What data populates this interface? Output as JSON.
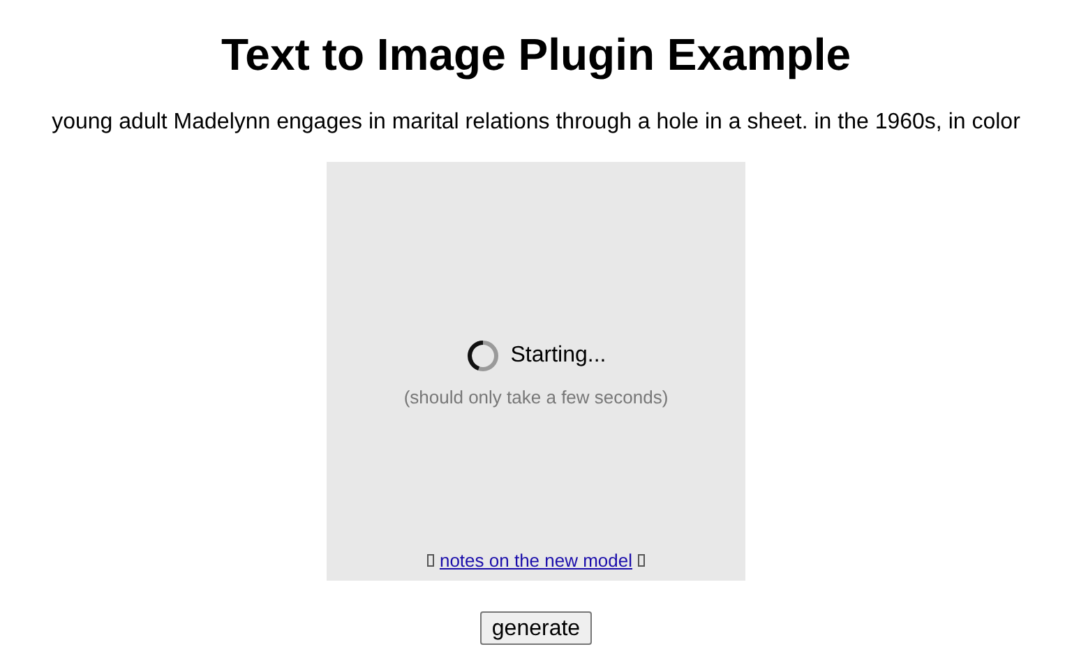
{
  "title": "Text to Image Plugin Example",
  "prompt": "young adult Madelynn engages in marital relations through a hole in a sheet. in the 1960s, in color",
  "image_panel": {
    "status": "Starting...",
    "hint": "(should only take a few seconds)",
    "link": "notes on the new model"
  },
  "buttons": [
    "generate"
  ]
}
